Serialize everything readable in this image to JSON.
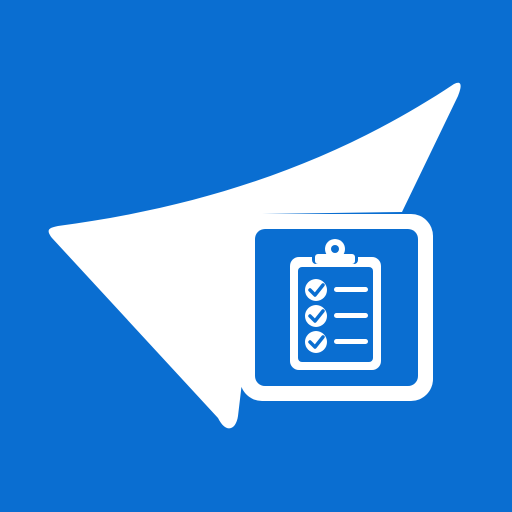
{
  "icon": {
    "name": "checklist-app-icon",
    "background_color": "#0A6ED1",
    "foreground_color": "#FFFFFF",
    "symbols": [
      "sail-shape-icon",
      "clipboard-checklist-icon"
    ],
    "checklist_items": 3
  }
}
